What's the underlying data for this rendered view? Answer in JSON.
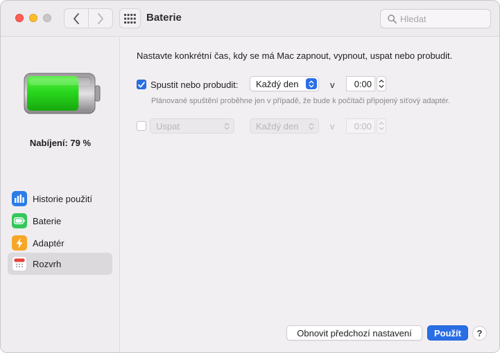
{
  "window": {
    "title": "Baterie"
  },
  "search": {
    "placeholder": "Hledat"
  },
  "sidebar": {
    "charge_label": "Nabíjení: 79 %",
    "charge_level_percent": 79,
    "items": [
      {
        "label": "Historie použití",
        "icon": "bar-chart-icon",
        "color": "#2b7ce9"
      },
      {
        "label": "Baterie",
        "icon": "battery-icon",
        "color": "#34c759"
      },
      {
        "label": "Adaptér",
        "icon": "lightning-icon",
        "color": "#f7a626"
      },
      {
        "label": "Rozvrh",
        "icon": "calendar-icon",
        "color": "#e5433a"
      }
    ],
    "selected": "Rozvrh"
  },
  "main": {
    "intro": "Nastavte konkrétní čas, kdy se má Mac zapnout, vypnout, uspat nebo probudit.",
    "row1": {
      "checked": true,
      "label": "Spustit nebo probudit:",
      "frequency": "Každý den",
      "v": "v",
      "time": "0:00"
    },
    "hint": "Plánované spuštění proběhne jen v případě, že bude k počítači připojený síťový adaptér.",
    "row2": {
      "checked": false,
      "action": "Uspat",
      "frequency": "Každý den",
      "v": "v",
      "time": "0:00"
    }
  },
  "buttons": {
    "restore": "Obnovit předchozí nastavení",
    "apply": "Použít",
    "help": "?"
  },
  "colors": {
    "accent": "#2a6ee6",
    "battery_green": "#34c759"
  }
}
